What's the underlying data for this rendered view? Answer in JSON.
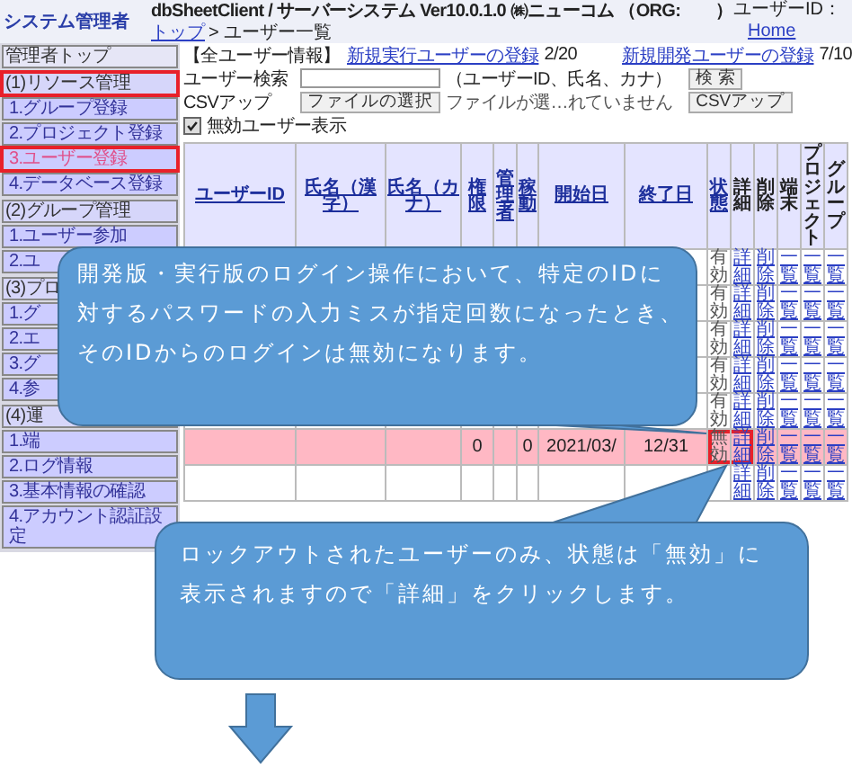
{
  "header": {
    "app_title": "システム管理者",
    "system_title": "dbSheetClient / サーバーシステム Ver10.0.1.0 ㈱ニューコム （ORG:　　）",
    "breadcrumb_link": "トップ",
    "breadcrumb_rest": "> ユーザー一覧",
    "user_id_label": "ユーザーID：",
    "home_link": "Home"
  },
  "sidebar": {
    "items": [
      {
        "kind": "top",
        "label": "管理者トップ",
        "selected": false,
        "highlighted": false
      },
      {
        "kind": "section",
        "label": "(1)リソース管理",
        "selected": false,
        "highlighted": true
      },
      {
        "kind": "item",
        "label": "1.グループ登録",
        "selected": false,
        "highlighted": false
      },
      {
        "kind": "item",
        "label": "2.プロジェクト登録",
        "selected": false,
        "highlighted": false
      },
      {
        "kind": "item",
        "label": "3.ユーザー登録",
        "selected": true,
        "highlighted": true
      },
      {
        "kind": "item",
        "label": "4.データベース登録",
        "selected": false,
        "highlighted": false
      },
      {
        "kind": "section",
        "label": "(2)グループ管理",
        "selected": false,
        "highlighted": false
      },
      {
        "kind": "item",
        "label": "1.ユーザー参加",
        "selected": false,
        "highlighted": false
      },
      {
        "kind": "item",
        "label": "2.ユ",
        "selected": false,
        "highlighted": false
      },
      {
        "kind": "section",
        "label": "(3)プロ",
        "selected": false,
        "highlighted": false
      },
      {
        "kind": "item",
        "label": "1.グ",
        "selected": false,
        "highlighted": false
      },
      {
        "kind": "item",
        "label": "2.エ",
        "selected": false,
        "highlighted": false
      },
      {
        "kind": "item",
        "label": "3.グ",
        "selected": false,
        "highlighted": false
      },
      {
        "kind": "item",
        "label": "4.参",
        "selected": false,
        "highlighted": false
      },
      {
        "kind": "section",
        "label": "(4)運",
        "selected": false,
        "highlighted": false
      },
      {
        "kind": "item",
        "label": "1.端",
        "selected": false,
        "highlighted": false
      },
      {
        "kind": "item",
        "label": "2.ログ情報",
        "selected": false,
        "highlighted": false
      },
      {
        "kind": "item",
        "label": "3.基本情報の確認",
        "selected": false,
        "highlighted": false
      },
      {
        "kind": "item",
        "label": "4.アカウント認証設定",
        "selected": false,
        "highlighted": false
      }
    ]
  },
  "info": {
    "title": "【全ユーザー情報】",
    "exec_link": "新規実行ユーザーの登録",
    "exec_count": "2/20",
    "dev_link": "新規開発ユーザーの登録",
    "dev_count": "7/10",
    "search_label": "ユーザー検索",
    "search_hint": "（ユーザーID、氏名、カナ）",
    "search_button": "検 索",
    "csv_label": "CSVアップ",
    "file_button": "ファイルの選択",
    "file_status": "ファイルが選…れていません",
    "csv_button": "CSVアップ",
    "show_disabled": {
      "label": "無効ユーザー表示",
      "checked": true
    }
  },
  "table": {
    "columns": [
      {
        "label": "ユーザーID",
        "sortable": true
      },
      {
        "label": "氏名（漢字）",
        "sortable": true
      },
      {
        "label": "氏名（カナ）",
        "sortable": true
      },
      {
        "label": "権限",
        "sortable": true
      },
      {
        "label": "管理者",
        "sortable": true
      },
      {
        "label": "稼動",
        "sortable": true
      },
      {
        "label": "開始日",
        "sortable": true
      },
      {
        "label": "終了日",
        "sortable": true
      },
      {
        "label": "状態",
        "sortable": true
      },
      {
        "label": "詳細",
        "sortable": false
      },
      {
        "label": "削除",
        "sortable": false
      },
      {
        "label": "端末",
        "sortable": false
      },
      {
        "label": "プロジェクト",
        "sortable": false
      },
      {
        "label": "グループ",
        "sortable": false
      }
    ],
    "rows": [
      {
        "status": "有効",
        "locked": false,
        "highlighted": false,
        "actions": [
          "詳細",
          "削除",
          "一覧",
          "一覧",
          "一覧"
        ]
      },
      {
        "status": "有効",
        "locked": false,
        "highlighted": false,
        "actions": [
          "詳細",
          "削除",
          "一覧",
          "一覧",
          "一覧"
        ]
      },
      {
        "status": "有効",
        "locked": false,
        "highlighted": false,
        "actions": [
          "詳細",
          "削除",
          "一覧",
          "一覧",
          "一覧"
        ]
      },
      {
        "status": "有効",
        "locked": false,
        "highlighted": false,
        "actions": [
          "詳細",
          "削除",
          "一覧",
          "一覧",
          "一覧"
        ]
      },
      {
        "status": "有効",
        "locked": false,
        "highlighted": false,
        "actions": [
          "詳細",
          "削除",
          "一覧",
          "一覧",
          "一覧"
        ]
      },
      {
        "status": "無効",
        "locked": true,
        "highlighted": true,
        "cells": [
          null,
          null,
          null,
          "0",
          null,
          "0",
          "2021/03/",
          "12/31"
        ],
        "actions": [
          "詳細",
          "削除",
          "一覧",
          "一覧",
          "一覧"
        ]
      },
      {
        "locked": false,
        "actions": [
          "詳細",
          "削除",
          "一覧",
          "一覧",
          "一覧"
        ]
      }
    ]
  },
  "callouts": [
    "開発版・実行版のログイン操作において、特定のIDに対するパスワードの入力ミスが指定回数になったとき、そのIDからのログインは無効になります。",
    "ロックアウトされたユーザーのみ、状態は「無効」に表示されますので「詳細」をクリックします。"
  ]
}
